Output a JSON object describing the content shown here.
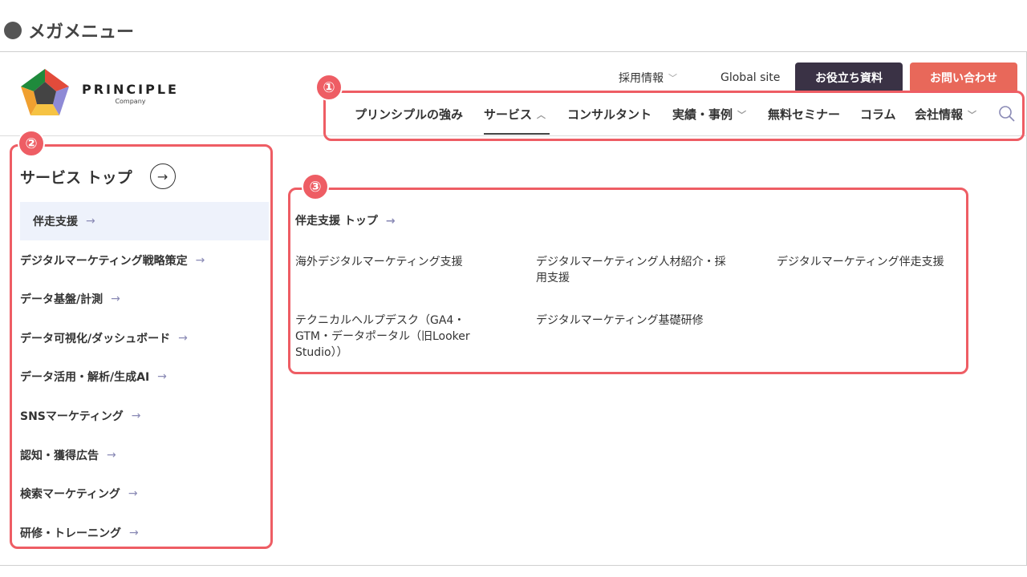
{
  "slide_title": "メガメニュー",
  "logo": {
    "brand": "PRINCIPLE",
    "sub": "Company"
  },
  "top_links": {
    "recruit": "採用情報",
    "global": "Global site",
    "resources_button": "お役立ち資料",
    "contact_button": "お問い合わせ"
  },
  "nav": [
    {
      "label": "プリンシプルの強み"
    },
    {
      "label": "サービス"
    },
    {
      "label": "コンサルタント"
    },
    {
      "label": "実績・事例"
    },
    {
      "label": "無料セミナー"
    },
    {
      "label": "コラム"
    },
    {
      "label": "会社情報"
    }
  ],
  "badges": [
    "①",
    "②",
    "③"
  ],
  "sidebar": {
    "top_label": "サービス トップ",
    "items": [
      "伴走支援",
      "デジタルマーケティング戦略策定",
      "データ基盤/計測",
      "データ可視化/ダッシュボード",
      "データ活用・解析/生成AI",
      "SNSマーケティング",
      "認知・獲得広告",
      "検索マーケティング",
      "研修・トレーニング"
    ]
  },
  "content": {
    "top": "伴走支援 トップ",
    "items": [
      "海外デジタルマーケティング支援",
      "デジタルマーケティング人材紹介・採用支援",
      "デジタルマーケティング伴走支援",
      "テクニカルヘルプデスク（GA4・GTM・データポータル（旧Looker Studio））",
      "デジタルマーケティング基礎研修"
    ]
  },
  "colors": {
    "accent": "#ee5d64",
    "dark_button": "#3a3245",
    "coral_button": "#e8685a"
  }
}
